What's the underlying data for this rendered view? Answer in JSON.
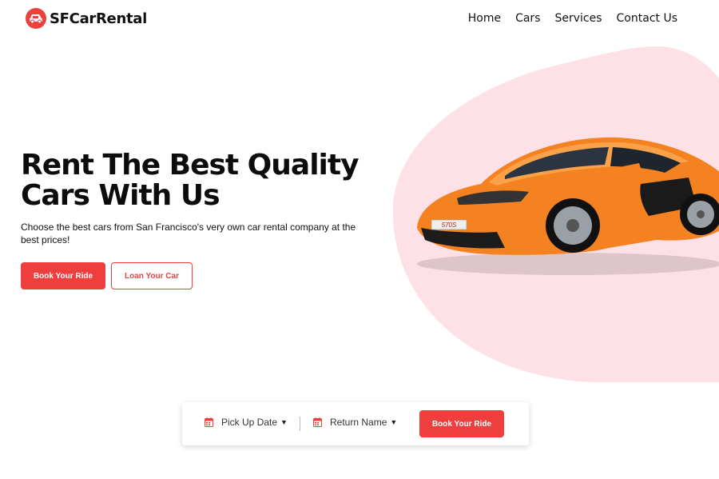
{
  "brand": {
    "name": "SFCarRental",
    "accent": "#ef3e3e",
    "blob_color": "#fde1e6"
  },
  "nav": {
    "items": [
      "Home",
      "Cars",
      "Services",
      "Contact Us"
    ]
  },
  "hero": {
    "title_line1": "Rent The Best Quality",
    "title_line2": "Cars With Us",
    "subtitle": "Choose the best cars from San Francisco's very own car rental company at the best prices!",
    "primary_button": "Book Your Ride",
    "secondary_button": "Loan Your Car",
    "car_plate": "570S"
  },
  "booking": {
    "pickup_label": "Pick Up Date",
    "return_label": "Return Name",
    "button_label": "Book Your Ride",
    "icons": [
      "calendar-icon",
      "caret-down-icon"
    ]
  }
}
